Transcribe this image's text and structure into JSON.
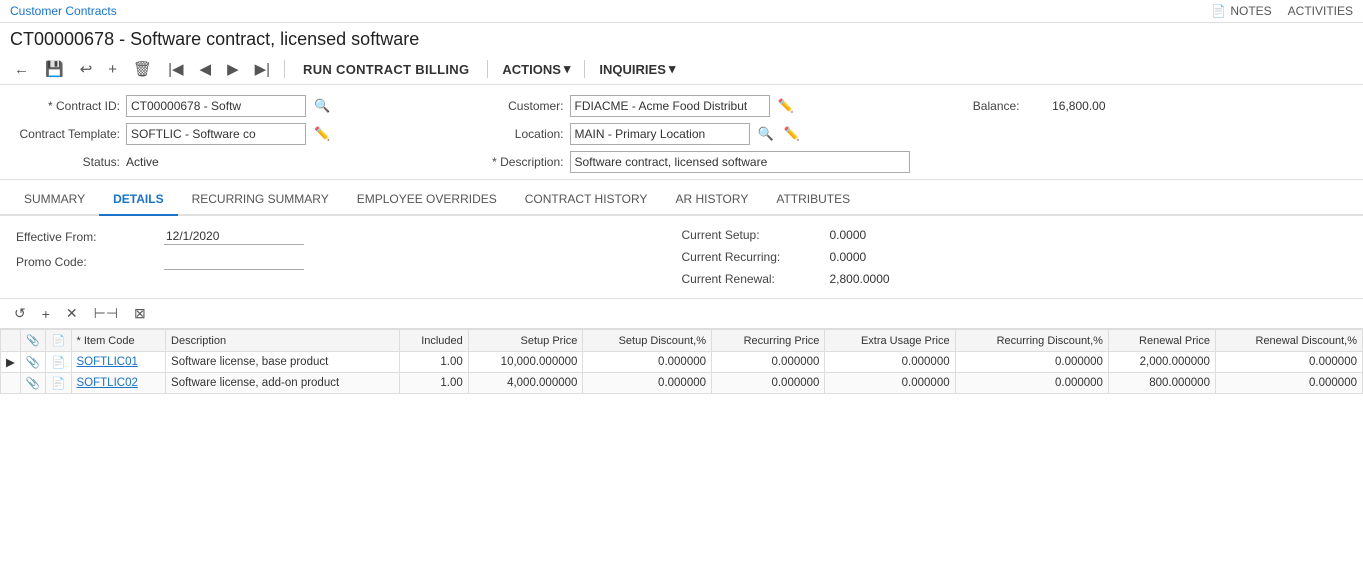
{
  "breadcrumb": {
    "label": "Customer Contracts",
    "link": "#"
  },
  "topnav": {
    "notes_label": "NOTES",
    "activities_label": "ACTIVITIES"
  },
  "page": {
    "title": "CT00000678 - Software contract, licensed software"
  },
  "toolbar": {
    "back_icon": "←",
    "save_icon": "💾",
    "undo_icon": "↩",
    "add_icon": "+",
    "delete_icon": "🗑",
    "first_icon": "|◀",
    "prev_icon": "◀",
    "next_icon": "▶",
    "last_icon": "▶|",
    "run_billing_label": "RUN CONTRACT BILLING",
    "actions_label": "ACTIONS",
    "actions_arrow": "▾",
    "inquiries_label": "INQUIRIES",
    "inquiries_arrow": "▾"
  },
  "form": {
    "contract_id_label": "* Contract ID:",
    "contract_id_value": "CT00000678 - Softw",
    "customer_label": "Customer:",
    "customer_value": "FDIACME - Acme Food Distribut",
    "balance_label": "Balance:",
    "balance_value": "16,800.00",
    "template_label": "Contract Template:",
    "template_value": "SOFTLIC - Software co",
    "location_label": "Location:",
    "location_value": "MAIN - Primary Location",
    "status_label": "Status:",
    "status_value": "Active",
    "description_label": "* Description:",
    "description_value": "Software contract, licensed software"
  },
  "tabs": [
    {
      "id": "summary",
      "label": "SUMMARY",
      "active": false
    },
    {
      "id": "details",
      "label": "DETAILS",
      "active": true
    },
    {
      "id": "recurring",
      "label": "RECURRING SUMMARY",
      "active": false
    },
    {
      "id": "employee",
      "label": "EMPLOYEE OVERRIDES",
      "active": false
    },
    {
      "id": "history",
      "label": "CONTRACT HISTORY",
      "active": false
    },
    {
      "id": "ar",
      "label": "AR HISTORY",
      "active": false
    },
    {
      "id": "attributes",
      "label": "ATTRIBUTES",
      "active": false
    }
  ],
  "details": {
    "effective_from_label": "Effective From:",
    "effective_from_value": "12/1/2020",
    "promo_code_label": "Promo Code:",
    "promo_code_value": "",
    "current_setup_label": "Current Setup:",
    "current_setup_value": "0.0000",
    "current_recurring_label": "Current Recurring:",
    "current_recurring_value": "0.0000",
    "current_renewal_label": "Current Renewal:",
    "current_renewal_value": "2,800.0000"
  },
  "grid": {
    "columns": [
      {
        "id": "arrow",
        "label": "",
        "class": "center"
      },
      {
        "id": "attach1",
        "label": "",
        "class": "center"
      },
      {
        "id": "attach2",
        "label": "",
        "class": "center"
      },
      {
        "id": "item_code",
        "label": "* Item Code",
        "class": "left"
      },
      {
        "id": "description",
        "label": "Description",
        "class": "left"
      },
      {
        "id": "included",
        "label": "Included",
        "class": "right"
      },
      {
        "id": "setup_price",
        "label": "Setup Price",
        "class": "right"
      },
      {
        "id": "setup_discount",
        "label": "Setup Discount,%",
        "class": "right"
      },
      {
        "id": "recurring_price",
        "label": "Recurring Price",
        "class": "right"
      },
      {
        "id": "extra_usage_price",
        "label": "Extra Usage Price",
        "class": "right"
      },
      {
        "id": "recurring_discount",
        "label": "Recurring Discount,%",
        "class": "right"
      },
      {
        "id": "renewal_price",
        "label": "Renewal Price",
        "class": "right"
      },
      {
        "id": "renewal_discount",
        "label": "Renewal Discount,%",
        "class": "right"
      }
    ],
    "rows": [
      {
        "arrow": "▶",
        "attach1": "📎",
        "attach2": "📄",
        "item_code": "SOFTLIC01",
        "description": "Software license, base product",
        "included": "1.00",
        "setup_price": "10,000.000000",
        "setup_discount": "0.000000",
        "recurring_price": "0.000000",
        "extra_usage_price": "0.000000",
        "recurring_discount": "0.000000",
        "renewal_price": "2,000.000000",
        "renewal_discount": "0.000000"
      },
      {
        "arrow": "",
        "attach1": "📎",
        "attach2": "📄",
        "item_code": "SOFTLIC02",
        "description": "Software license, add-on product",
        "included": "1.00",
        "setup_price": "4,000.000000",
        "setup_discount": "0.000000",
        "recurring_price": "0.000000",
        "extra_usage_price": "0.000000",
        "recurring_discount": "0.000000",
        "renewal_price": "800.000000",
        "renewal_discount": "0.000000"
      }
    ]
  }
}
